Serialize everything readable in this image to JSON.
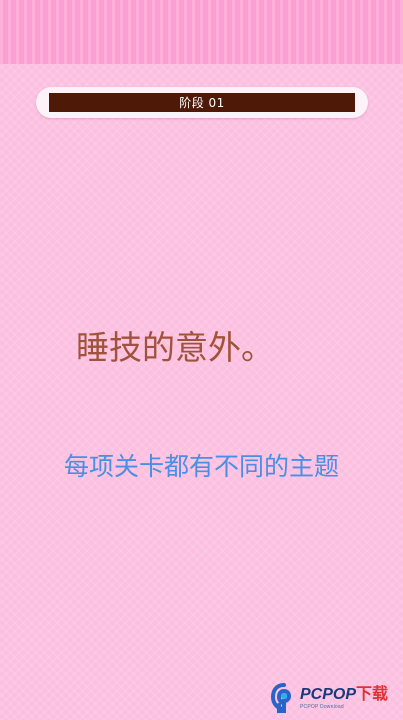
{
  "header": {
    "stage_label": "阶段 01"
  },
  "main": {
    "title": "睡技的意外。",
    "subtitle": "每项关卡都有不同的主题"
  },
  "watermark": {
    "brand": "PCPOP",
    "brand_suffix": "下载",
    "tagline": "PCPOP Download",
    "icon": "pcpop-logo-icon"
  },
  "colors": {
    "background": "#fcbfe0",
    "banner": "#fb9fd2",
    "stage_bar": "#4e1a07",
    "title_text": "#a0523a",
    "subtitle_text": "#4a8fe6"
  }
}
